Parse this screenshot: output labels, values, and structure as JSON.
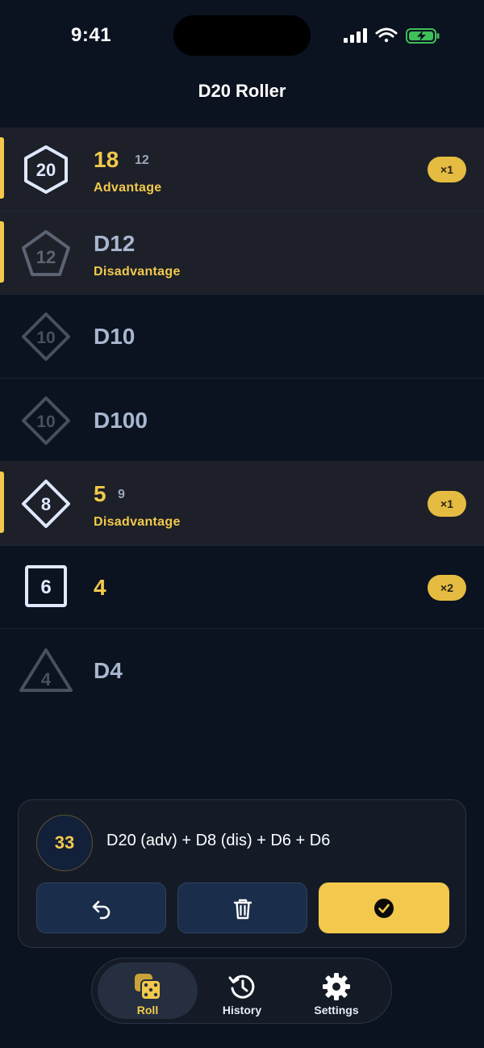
{
  "status_bar": {
    "time": "9:41"
  },
  "app": {
    "title": "D20 Roller"
  },
  "dice": [
    {
      "label": "D20",
      "face": "20",
      "result": "18",
      "secondary": "12",
      "mode": "Advantage",
      "count": "×1",
      "active": true
    },
    {
      "label": "D12",
      "face": "12",
      "result": "",
      "secondary": "",
      "mode": "Disadvantage",
      "count": "",
      "active": true
    },
    {
      "label": "D10",
      "face": "10",
      "result": "",
      "secondary": "",
      "mode": "",
      "count": "",
      "active": false
    },
    {
      "label": "D100",
      "face": "10",
      "result": "",
      "secondary": "",
      "mode": "",
      "count": "",
      "active": false
    },
    {
      "label": "D8",
      "face": "8",
      "result": "5",
      "secondary": "9",
      "mode": "Disadvantage",
      "count": "×1",
      "active": true
    },
    {
      "label": "D6",
      "face": "6",
      "result": "4",
      "secondary": "",
      "mode": "",
      "count": "×2",
      "active": false
    },
    {
      "label": "D4",
      "face": "4",
      "result": "",
      "secondary": "",
      "mode": "",
      "count": "",
      "active": false
    }
  ],
  "summary": {
    "total": "33",
    "expression": "D20 (adv) + D8 (dis) + D6 + D6"
  },
  "tabs": [
    {
      "label": "Roll",
      "icon": "dice-icon",
      "selected": true
    },
    {
      "label": "History",
      "icon": "history-icon",
      "selected": false
    },
    {
      "label": "Settings",
      "icon": "gear-icon",
      "selected": false
    }
  ],
  "colors": {
    "background": "#0b1220",
    "accent": "#f2c94c",
    "active_row": "#1d2028",
    "muted": "#a9b6cf",
    "button": "#1a2d4a"
  }
}
